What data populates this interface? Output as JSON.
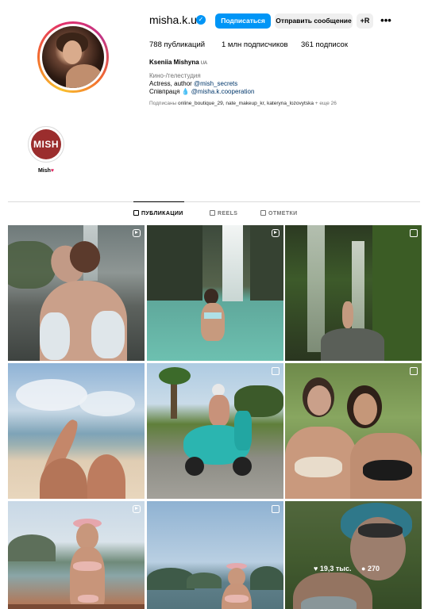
{
  "profile": {
    "username": "misha.k.ua",
    "verified_icon": "verified-badge-icon",
    "follow_label": "Подписаться",
    "message_label": "Отправить сообщение",
    "add_user_label": "+R",
    "more_label": "•••",
    "stats": {
      "posts": "788 публикаций",
      "followers": "1 млн подписчиков",
      "following": "361 подписок"
    },
    "full_name": "Kseniia Mishyna",
    "full_name_suffix": "UA",
    "category": "Кино-/телестудия",
    "bio_line1_prefix": "Actress, author ",
    "bio_line1_link": "@mish_secrets",
    "bio_line2_prefix": "Співпраця 💧 ",
    "bio_line2_link": "@misha.k.cooperation",
    "followed_by_prefix": "Подписаны ",
    "followed_by_names": "online_boutique_29, nate_makeup_kr, kateryna_lozovytska",
    "followed_by_suffix": " + еще 26"
  },
  "highlights": [
    {
      "cover_text": "MISH",
      "label": "Mish",
      "label_emoji": "♥"
    }
  ],
  "tabs": [
    {
      "label": "ПУБЛИКАЦИИ",
      "active": true,
      "icon": "grid-icon"
    },
    {
      "label": "REELS",
      "active": false,
      "icon": "reels-icon"
    },
    {
      "label": "ОТМЕТКИ",
      "active": false,
      "icon": "tagged-icon"
    }
  ],
  "posts": [
    {
      "badge": "reel",
      "scene": "selfie-waterfall"
    },
    {
      "badge": "reel",
      "scene": "waterfall-pool"
    },
    {
      "badge": "multi",
      "scene": "jungle-waterfall"
    },
    {
      "badge": "none",
      "scene": "beach-legs"
    },
    {
      "badge": "multi",
      "scene": "scooter"
    },
    {
      "badge": "multi",
      "scene": "two-women"
    },
    {
      "badge": "reel",
      "scene": "boat-bikini"
    },
    {
      "badge": "multi",
      "scene": "islands-view"
    },
    {
      "badge": "none",
      "scene": "hat-selfie",
      "hover": {
        "likes": "19,3 тыс.",
        "comments": "270"
      }
    }
  ],
  "colors": {
    "accent": "#0095f6",
    "link": "#00376b",
    "secondary_text": "#737373",
    "highlight_cover": "#9b2d2d"
  }
}
